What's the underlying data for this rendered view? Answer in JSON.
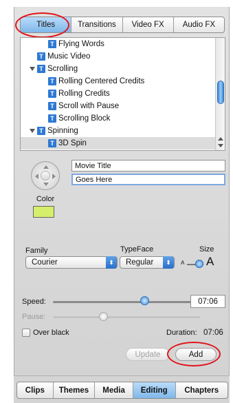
{
  "top_tabs": [
    {
      "label": "Titles",
      "active": true
    },
    {
      "label": "Transitions",
      "active": false
    },
    {
      "label": "Video FX",
      "active": false
    },
    {
      "label": "Audio FX",
      "active": false
    }
  ],
  "title_list": [
    {
      "label": "Flying Words",
      "level": 1,
      "disclosure": false,
      "selected": false
    },
    {
      "label": "Music Video",
      "level": 0,
      "disclosure": false,
      "selected": false
    },
    {
      "label": "Scrolling",
      "level": 0,
      "disclosure": true,
      "selected": false
    },
    {
      "label": "Rolling Centered Credits",
      "level": 1,
      "disclosure": false,
      "selected": false
    },
    {
      "label": "Rolling Credits",
      "level": 1,
      "disclosure": false,
      "selected": false
    },
    {
      "label": "Scroll with Pause",
      "level": 1,
      "disclosure": false,
      "selected": false
    },
    {
      "label": "Scrolling Block",
      "level": 1,
      "disclosure": false,
      "selected": false
    },
    {
      "label": "Spinning",
      "level": 0,
      "disclosure": true,
      "selected": false
    },
    {
      "label": "3D Spin",
      "level": 1,
      "disclosure": false,
      "selected": true
    }
  ],
  "text_fields": {
    "line1": "Movie Title",
    "line2": "Goes Here"
  },
  "color": {
    "label": "Color",
    "swatch": "#d6ef6b"
  },
  "font": {
    "family_label": "Family",
    "family_value": "Courier",
    "typeface_label": "TypeFace",
    "typeface_value": "Regular",
    "size_label": "Size",
    "size_small": "A",
    "size_large": "A"
  },
  "timing": {
    "speed_label": "Speed:",
    "speed_value": "07:06",
    "pause_label": "Pause:",
    "over_black_label": "Over black",
    "over_black_checked": false,
    "duration_label": "Duration:",
    "duration_value": "07:06"
  },
  "buttons": {
    "update": "Update",
    "add": "Add"
  },
  "bottom_tabs": [
    {
      "label": "Clips",
      "active": false
    },
    {
      "label": "Themes",
      "active": false
    },
    {
      "label": "Media",
      "active": false
    },
    {
      "label": "Editing",
      "active": true
    },
    {
      "label": "Chapters",
      "active": false
    }
  ],
  "colors": {
    "accent": "#7fb7ea",
    "highlight_circle": "#e0141a"
  }
}
